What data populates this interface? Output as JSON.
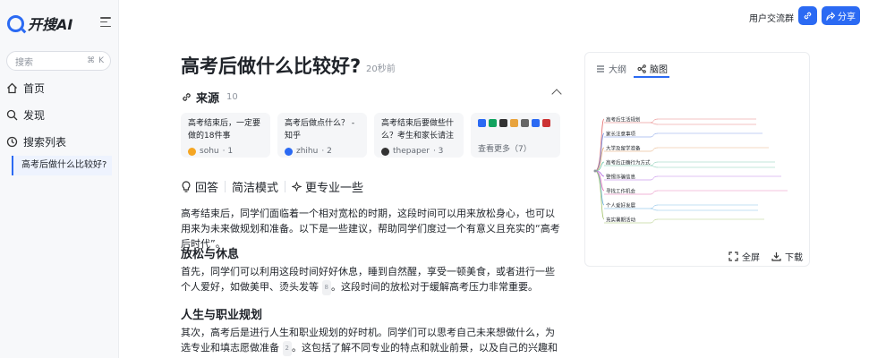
{
  "app": {
    "logo_text": "开搜AI"
  },
  "sidebar": {
    "search_placeholder": "搜索",
    "search_shortcut_1": "⌘",
    "search_shortcut_2": "K",
    "items": [
      {
        "label": "首页",
        "icon": "home-icon"
      },
      {
        "label": "发现",
        "icon": "discover-icon"
      },
      {
        "label": "搜索列表",
        "icon": "history-icon"
      }
    ],
    "sub_item": "高考后做什么比较好?"
  },
  "header": {
    "group_link": "用户交流群",
    "share_label": "分享"
  },
  "article": {
    "title": "高考后做什么比较好?",
    "time": "20秒前",
    "sources_label": "来源",
    "sources_count": "10",
    "sources": [
      {
        "title": "高考结束后，一定要做的18件事",
        "site": "sohu",
        "index": "· 1",
        "color": "#f5a623"
      },
      {
        "title": "高考后做点什么？ - 知乎",
        "site": "zhihu",
        "index": "· 2",
        "color": "#2b6af3"
      },
      {
        "title": "高考结束后要做些什么？考生和家长请注意…",
        "site": "thepaper",
        "index": "· 3",
        "color": "#333333"
      }
    ],
    "more_label": "查看更多（7）",
    "tabs": [
      {
        "label": "回答",
        "icon": "bulb-icon"
      },
      {
        "label": "简洁模式",
        "icon": ""
      },
      {
        "label": "更专业一些",
        "icon": "sparkle-icon"
      }
    ],
    "intro": "高考结束后，同学们面临着一个相对宽松的时期，这段时间可以用来放松身心，也可以用来为未来做规划和准备。以下是一些建议，帮助同学们度过一个有意义且充实的“高考后时代”。",
    "section1_title": "放松与休息",
    "section1_text": "首先，同学们可以利用这段时间好好休息，睡到自然醒，享受一顿美食，或者进行一些个人爱好，如做美甲、烫头发等",
    "section1_cite": "8",
    "section1_tail": "。这段时间的放松对于缓解高考压力非常重要。",
    "section2_title": "人生与职业规划",
    "section2_text": "其次，高考后是进行人生和职业规划的好时机。同学们可以思考自己未来想做什么，为选专业和填志愿做准备",
    "section2_cite": "2",
    "section2_tail": "。这包括了解不同专业的特点和就业前景，以及自己的兴趣和优势。"
  },
  "panel": {
    "tab_outline": "大纲",
    "tab_mindmap": "脑图",
    "fullscreen_label": "全屏",
    "download_label": "下载",
    "mindmap_nodes": [
      "高考后生活规划",
      "家长注意事项",
      "大学及留学准备",
      "高考后正确行为方式",
      "警惕诈骗信息",
      "寻找工作机会",
      "个人爱好发展",
      "充实暑期活动"
    ]
  }
}
